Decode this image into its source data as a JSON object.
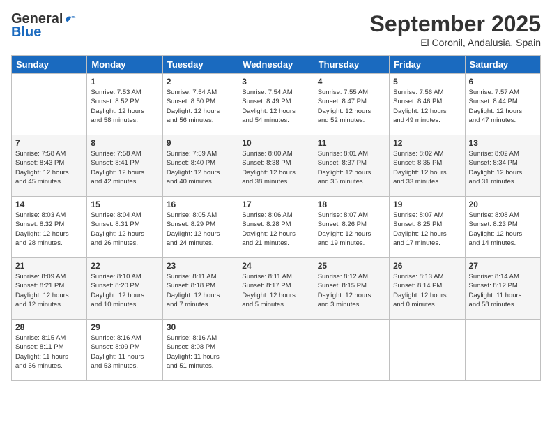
{
  "header": {
    "logo_general": "General",
    "logo_blue": "Blue",
    "month_title": "September 2025",
    "subtitle": "El Coronil, Andalusia, Spain"
  },
  "days_of_week": [
    "Sunday",
    "Monday",
    "Tuesday",
    "Wednesday",
    "Thursday",
    "Friday",
    "Saturday"
  ],
  "weeks": [
    [
      {
        "day": "",
        "info": ""
      },
      {
        "day": "1",
        "info": "Sunrise: 7:53 AM\nSunset: 8:52 PM\nDaylight: 12 hours\nand 58 minutes."
      },
      {
        "day": "2",
        "info": "Sunrise: 7:54 AM\nSunset: 8:50 PM\nDaylight: 12 hours\nand 56 minutes."
      },
      {
        "day": "3",
        "info": "Sunrise: 7:54 AM\nSunset: 8:49 PM\nDaylight: 12 hours\nand 54 minutes."
      },
      {
        "day": "4",
        "info": "Sunrise: 7:55 AM\nSunset: 8:47 PM\nDaylight: 12 hours\nand 52 minutes."
      },
      {
        "day": "5",
        "info": "Sunrise: 7:56 AM\nSunset: 8:46 PM\nDaylight: 12 hours\nand 49 minutes."
      },
      {
        "day": "6",
        "info": "Sunrise: 7:57 AM\nSunset: 8:44 PM\nDaylight: 12 hours\nand 47 minutes."
      }
    ],
    [
      {
        "day": "7",
        "info": "Sunrise: 7:58 AM\nSunset: 8:43 PM\nDaylight: 12 hours\nand 45 minutes."
      },
      {
        "day": "8",
        "info": "Sunrise: 7:58 AM\nSunset: 8:41 PM\nDaylight: 12 hours\nand 42 minutes."
      },
      {
        "day": "9",
        "info": "Sunrise: 7:59 AM\nSunset: 8:40 PM\nDaylight: 12 hours\nand 40 minutes."
      },
      {
        "day": "10",
        "info": "Sunrise: 8:00 AM\nSunset: 8:38 PM\nDaylight: 12 hours\nand 38 minutes."
      },
      {
        "day": "11",
        "info": "Sunrise: 8:01 AM\nSunset: 8:37 PM\nDaylight: 12 hours\nand 35 minutes."
      },
      {
        "day": "12",
        "info": "Sunrise: 8:02 AM\nSunset: 8:35 PM\nDaylight: 12 hours\nand 33 minutes."
      },
      {
        "day": "13",
        "info": "Sunrise: 8:02 AM\nSunset: 8:34 PM\nDaylight: 12 hours\nand 31 minutes."
      }
    ],
    [
      {
        "day": "14",
        "info": "Sunrise: 8:03 AM\nSunset: 8:32 PM\nDaylight: 12 hours\nand 28 minutes."
      },
      {
        "day": "15",
        "info": "Sunrise: 8:04 AM\nSunset: 8:31 PM\nDaylight: 12 hours\nand 26 minutes."
      },
      {
        "day": "16",
        "info": "Sunrise: 8:05 AM\nSunset: 8:29 PM\nDaylight: 12 hours\nand 24 minutes."
      },
      {
        "day": "17",
        "info": "Sunrise: 8:06 AM\nSunset: 8:28 PM\nDaylight: 12 hours\nand 21 minutes."
      },
      {
        "day": "18",
        "info": "Sunrise: 8:07 AM\nSunset: 8:26 PM\nDaylight: 12 hours\nand 19 minutes."
      },
      {
        "day": "19",
        "info": "Sunrise: 8:07 AM\nSunset: 8:25 PM\nDaylight: 12 hours\nand 17 minutes."
      },
      {
        "day": "20",
        "info": "Sunrise: 8:08 AM\nSunset: 8:23 PM\nDaylight: 12 hours\nand 14 minutes."
      }
    ],
    [
      {
        "day": "21",
        "info": "Sunrise: 8:09 AM\nSunset: 8:21 PM\nDaylight: 12 hours\nand 12 minutes."
      },
      {
        "day": "22",
        "info": "Sunrise: 8:10 AM\nSunset: 8:20 PM\nDaylight: 12 hours\nand 10 minutes."
      },
      {
        "day": "23",
        "info": "Sunrise: 8:11 AM\nSunset: 8:18 PM\nDaylight: 12 hours\nand 7 minutes."
      },
      {
        "day": "24",
        "info": "Sunrise: 8:11 AM\nSunset: 8:17 PM\nDaylight: 12 hours\nand 5 minutes."
      },
      {
        "day": "25",
        "info": "Sunrise: 8:12 AM\nSunset: 8:15 PM\nDaylight: 12 hours\nand 3 minutes."
      },
      {
        "day": "26",
        "info": "Sunrise: 8:13 AM\nSunset: 8:14 PM\nDaylight: 12 hours\nand 0 minutes."
      },
      {
        "day": "27",
        "info": "Sunrise: 8:14 AM\nSunset: 8:12 PM\nDaylight: 11 hours\nand 58 minutes."
      }
    ],
    [
      {
        "day": "28",
        "info": "Sunrise: 8:15 AM\nSunset: 8:11 PM\nDaylight: 11 hours\nand 56 minutes."
      },
      {
        "day": "29",
        "info": "Sunrise: 8:16 AM\nSunset: 8:09 PM\nDaylight: 11 hours\nand 53 minutes."
      },
      {
        "day": "30",
        "info": "Sunrise: 8:16 AM\nSunset: 8:08 PM\nDaylight: 11 hours\nand 51 minutes."
      },
      {
        "day": "",
        "info": ""
      },
      {
        "day": "",
        "info": ""
      },
      {
        "day": "",
        "info": ""
      },
      {
        "day": "",
        "info": ""
      }
    ]
  ]
}
